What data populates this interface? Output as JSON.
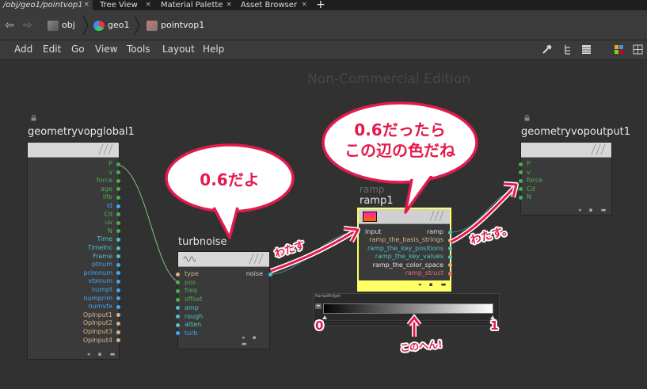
{
  "tabs": [
    {
      "label": "/obj/geo1/pointvop1",
      "active": true
    },
    {
      "label": "Tree View",
      "active": false
    },
    {
      "label": "Material Palette",
      "active": false
    },
    {
      "label": "Asset Browser",
      "active": false
    }
  ],
  "tab_close_glyph": "×",
  "tab_add_glyph": "+",
  "path": {
    "back_glyph": "⇦",
    "forward_glyph": "⇨",
    "crumbs": [
      {
        "label": "obj",
        "icon": "obj-network-icon"
      },
      {
        "label": "geo1",
        "icon": "geometry-icon"
      },
      {
        "label": "pointvop1",
        "icon": "vop-icon"
      }
    ]
  },
  "menu": [
    "Add",
    "Edit",
    "Go",
    "View",
    "Tools",
    "Layout",
    "Help"
  ],
  "toolbar_icons": [
    "wrench-icon",
    "tree-layout-icon",
    "list-view-icon",
    "grid-view-icon",
    "tile-view-icon"
  ],
  "watermark": "Non-Commercial Edition",
  "nodes": {
    "global": {
      "title": "geometryvopglobal1",
      "outputs": [
        {
          "name": "P",
          "color": "#4caf50"
        },
        {
          "name": "v",
          "color": "#4caf50"
        },
        {
          "name": "force",
          "color": "#4caf50"
        },
        {
          "name": "age",
          "color": "#4caf50"
        },
        {
          "name": "life",
          "color": "#4caf50"
        },
        {
          "name": "id",
          "color": "#3fa9f5"
        },
        {
          "name": "Cd",
          "color": "#4caf50"
        },
        {
          "name": "uv",
          "color": "#4caf50"
        },
        {
          "name": "N",
          "color": "#4caf50"
        },
        {
          "name": "Time",
          "color": "#4fc3c7"
        },
        {
          "name": "TimeInc",
          "color": "#4fc3c7"
        },
        {
          "name": "Frame",
          "color": "#4fc3c7"
        },
        {
          "name": "ptnum",
          "color": "#3fa9f5"
        },
        {
          "name": "primnum",
          "color": "#3fa9f5"
        },
        {
          "name": "vtxnum",
          "color": "#3fa9f5"
        },
        {
          "name": "numpt",
          "color": "#3fa9f5"
        },
        {
          "name": "numprim",
          "color": "#3fa9f5"
        },
        {
          "name": "numvtx",
          "color": "#3fa9f5"
        },
        {
          "name": "OpInput1",
          "color": "#d8b48a"
        },
        {
          "name": "OpInput2",
          "color": "#d8b48a"
        },
        {
          "name": "OpInput3",
          "color": "#d8b48a"
        },
        {
          "name": "OpInput4",
          "color": "#d8b48a"
        }
      ]
    },
    "turbnoise": {
      "title": "turbnoise",
      "inputs": [
        {
          "name": "type",
          "color": "#d8b48a"
        },
        {
          "name": "pos",
          "color": "#4caf50"
        },
        {
          "name": "freq",
          "color": "#4caf50"
        },
        {
          "name": "offset",
          "color": "#4caf50"
        },
        {
          "name": "amp",
          "color": "#4fc3c7"
        },
        {
          "name": "rough",
          "color": "#4fc3c7"
        },
        {
          "name": "atten",
          "color": "#4fc3c7"
        },
        {
          "name": "turb",
          "color": "#3fa9f5"
        }
      ],
      "output": {
        "name": "noise",
        "color": "#4fc3c7"
      }
    },
    "ramp": {
      "title": "ramp1",
      "title_ghost": "ramp",
      "input": {
        "name": "input",
        "color": "#4fc3c7"
      },
      "output": {
        "name": "ramp",
        "color": "#4fc3c7"
      },
      "params": [
        {
          "name": "ramp_the_basis_strings",
          "color": "#d8b48a"
        },
        {
          "name": "ramp_the_key_positions",
          "color": "#4fc3c7"
        },
        {
          "name": "ramp_the_key_values",
          "color": "#4fc3c7"
        },
        {
          "name": "ramp_the_color_space",
          "color": "#d8b48a"
        },
        {
          "name": "ramp_struct",
          "color": "#e57373"
        }
      ],
      "highlight": "#ffff66"
    },
    "output": {
      "title": "geometryvopoutput1",
      "inputs": [
        {
          "name": "P",
          "color": "#4caf50"
        },
        {
          "name": "v",
          "color": "#4caf50"
        },
        {
          "name": "force",
          "color": "#4caf50"
        },
        {
          "name": "Cd",
          "color": "#4caf50"
        },
        {
          "name": "N",
          "color": "#4caf50"
        }
      ]
    }
  },
  "ramp_widget": {
    "label": "RampWidget",
    "small_button": "◂▸"
  },
  "annotations": {
    "bubble1": "0.6だよ",
    "bubble2_line1": "0.6だったら",
    "bubble2_line2": "この辺の色だね",
    "pass1": "わたす",
    "pass2": "わたす。",
    "zero": "0",
    "one": "1",
    "here": "このへん!"
  },
  "colors": {
    "annotation": "#e31a4c",
    "wire": "#7fbf7f",
    "canvas": "#313131"
  }
}
